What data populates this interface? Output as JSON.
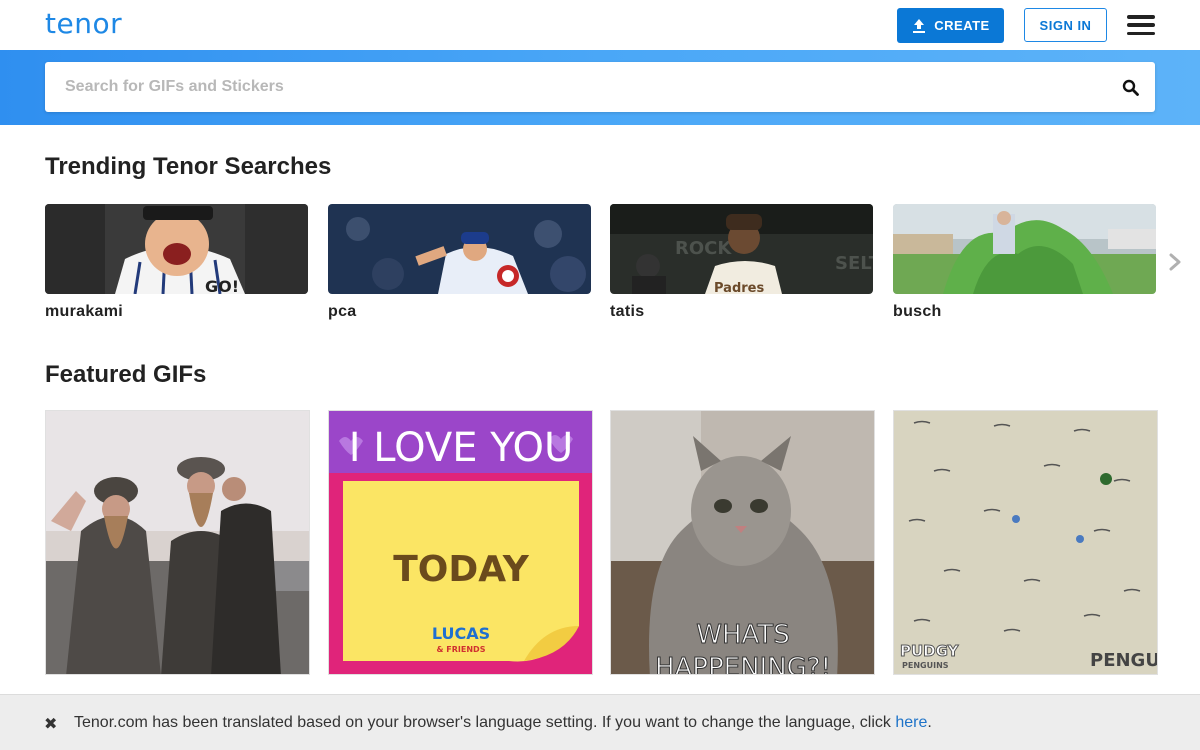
{
  "header": {
    "logo": "tenor",
    "create_label": "CREATE",
    "signin_label": "SIGN IN"
  },
  "search": {
    "placeholder": "Search for GIFs and Stickers"
  },
  "trending": {
    "title": "Trending Tenor Searches",
    "items": [
      {
        "label": "murakami"
      },
      {
        "label": "pca"
      },
      {
        "label": "tatis"
      },
      {
        "label": "busch"
      }
    ]
  },
  "featured": {
    "title": "Featured GIFs",
    "gifs": [
      {
        "caption": ""
      },
      {
        "top_text": "I LOVE YOU",
        "middle_text": "TODAY",
        "brand_line1": "LUCAS",
        "brand_line2": "& FRIENDS"
      },
      {
        "caption_line1": "WHATS",
        "caption_line2": "HAPPENING?!"
      },
      {
        "brand_left_line1": "PUDGY",
        "brand_left_line2": "PENGUINS",
        "brand_right": "PENGU"
      }
    ]
  },
  "banner": {
    "close_icon": "✖",
    "text": "Tenor.com has been translated based on your browser's language setting. If you want to change the language, click ",
    "link": "here",
    "suffix": "."
  },
  "colors": {
    "brand": "#1e88e5",
    "create_bg": "#0b78d6",
    "search_band_start": "#2f8ff0",
    "search_band_end": "#5db3f9"
  }
}
